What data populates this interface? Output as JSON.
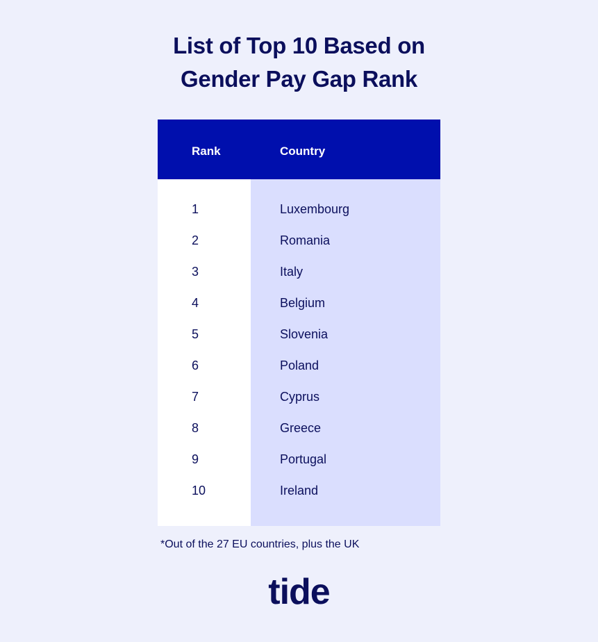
{
  "title_line1": "List of Top 10 Based on",
  "title_line2": "Gender Pay Gap Rank",
  "table": {
    "headers": {
      "rank": "Rank",
      "country": "Country"
    },
    "rows": [
      {
        "rank": "1",
        "country": "Luxembourg"
      },
      {
        "rank": "2",
        "country": "Romania"
      },
      {
        "rank": "3",
        "country": "Italy"
      },
      {
        "rank": "4",
        "country": "Belgium"
      },
      {
        "rank": "5",
        "country": "Slovenia"
      },
      {
        "rank": "6",
        "country": "Poland"
      },
      {
        "rank": "7",
        "country": "Cyprus"
      },
      {
        "rank": "8",
        "country": "Greece"
      },
      {
        "rank": "9",
        "country": "Portugal"
      },
      {
        "rank": "10",
        "country": "Ireland"
      }
    ]
  },
  "footnote": "*Out of the 27 EU countries, plus the UK",
  "logo": "tide",
  "colors": {
    "header_bg": "#000fad",
    "country_bg": "#dadefe",
    "text": "#0b0f5c",
    "page_bg": "#eef0fc"
  }
}
